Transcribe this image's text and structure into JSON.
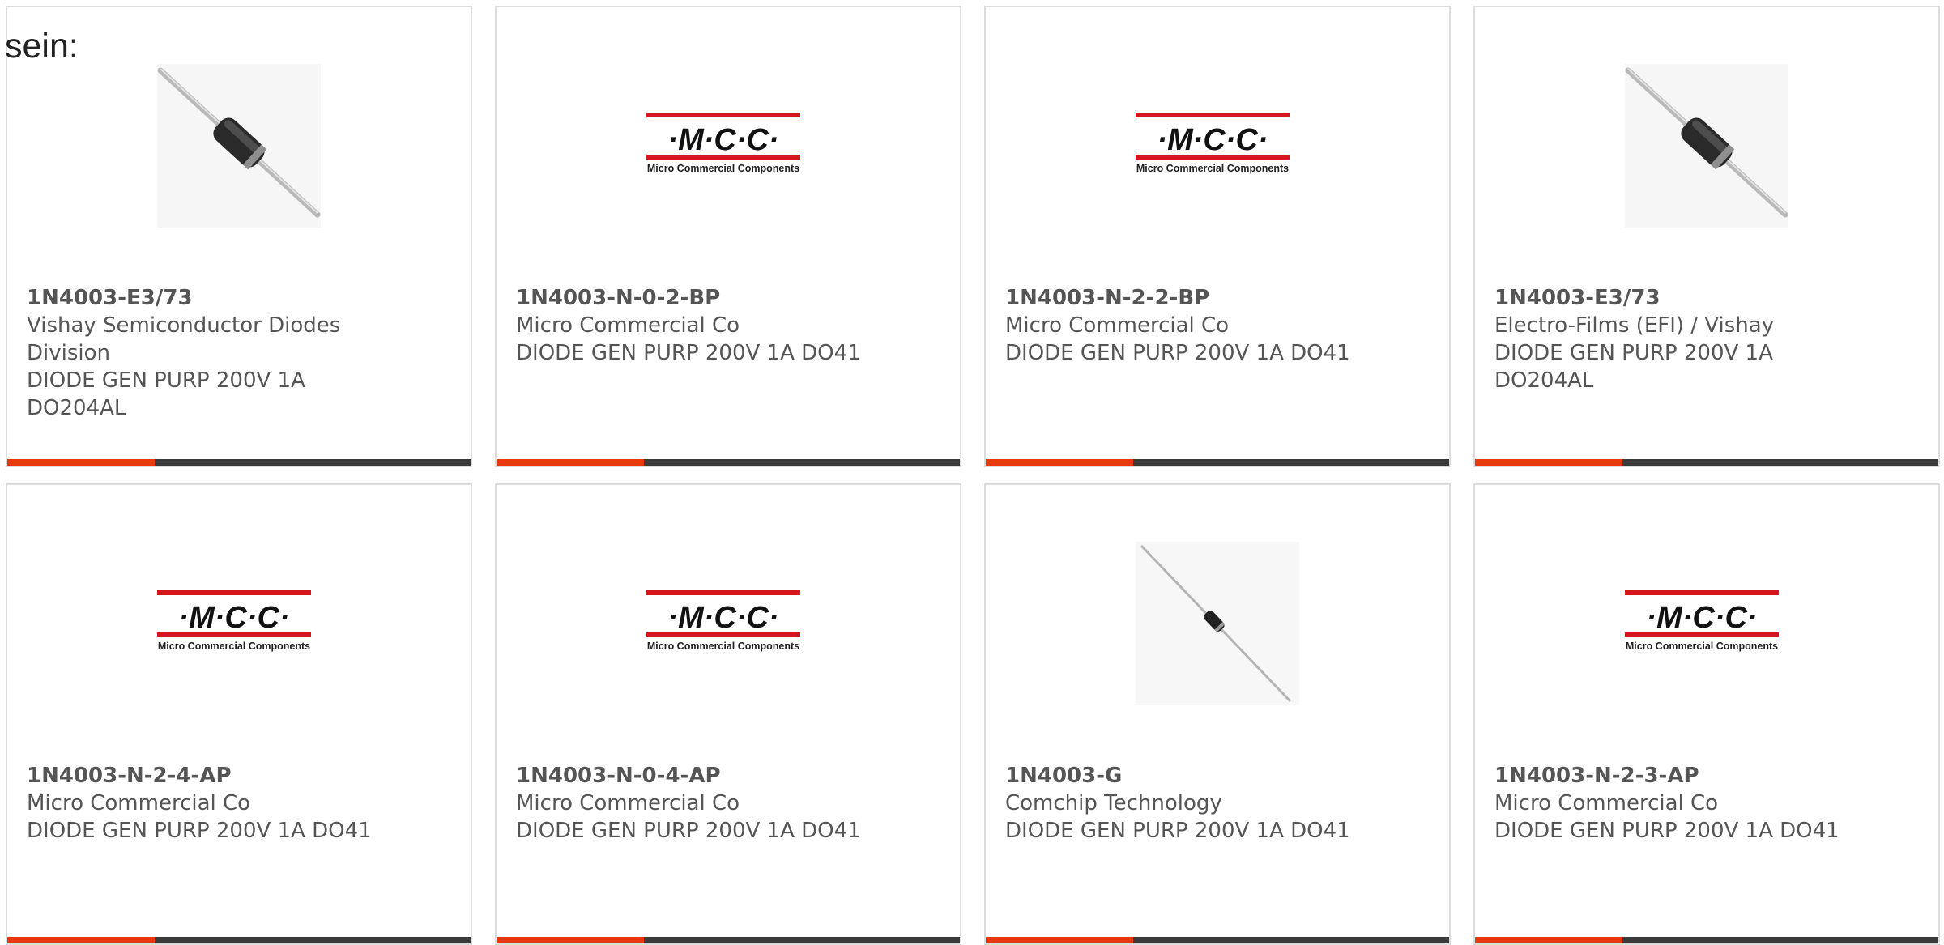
{
  "intro_text": "sein:",
  "colors": {
    "accent": "#e8380d",
    "bar": "#3a3a3a",
    "text": "#555555",
    "border": "#dcdcdc",
    "mcc_red": "#d6161f"
  },
  "mcc_logo": {
    "mark": "·M·C·C·",
    "tagline": "Micro Commercial Components"
  },
  "products": [
    {
      "part": "1N4003-E3/73",
      "manufacturer": "Vishay Semiconductor Diodes Division",
      "description": "DIODE GEN PURP 200V 1A DO204AL",
      "image": "axial-diode-photo"
    },
    {
      "part": "1N4003-N-0-2-BP",
      "manufacturer": "Micro Commercial Co",
      "description": "DIODE GEN PURP 200V 1A DO41",
      "image": "mcc-logo"
    },
    {
      "part": "1N4003-N-2-2-BP",
      "manufacturer": "Micro Commercial Co",
      "description": "DIODE GEN PURP 200V 1A DO41",
      "image": "mcc-logo"
    },
    {
      "part": "1N4003-E3/73",
      "manufacturer": "Electro-Films (EFI) / Vishay",
      "description": "DIODE GEN PURP 200V 1A DO204AL",
      "image": "axial-diode-photo"
    },
    {
      "part": "1N4003-N-2-4-AP",
      "manufacturer": "Micro Commercial Co",
      "description": "DIODE GEN PURP 200V 1A DO41",
      "image": "mcc-logo"
    },
    {
      "part": "1N4003-N-0-4-AP",
      "manufacturer": "Micro Commercial Co",
      "description": "DIODE GEN PURP 200V 1A DO41",
      "image": "mcc-logo"
    },
    {
      "part": "1N4003-G",
      "manufacturer": "Comchip Technology",
      "description": "DIODE GEN PURP 200V 1A DO41",
      "image": "axial-diode-long-photo"
    },
    {
      "part": "1N4003-N-2-3-AP",
      "manufacturer": "Micro Commercial Co",
      "description": "DIODE GEN PURP 200V 1A DO41",
      "image": "mcc-logo"
    }
  ]
}
